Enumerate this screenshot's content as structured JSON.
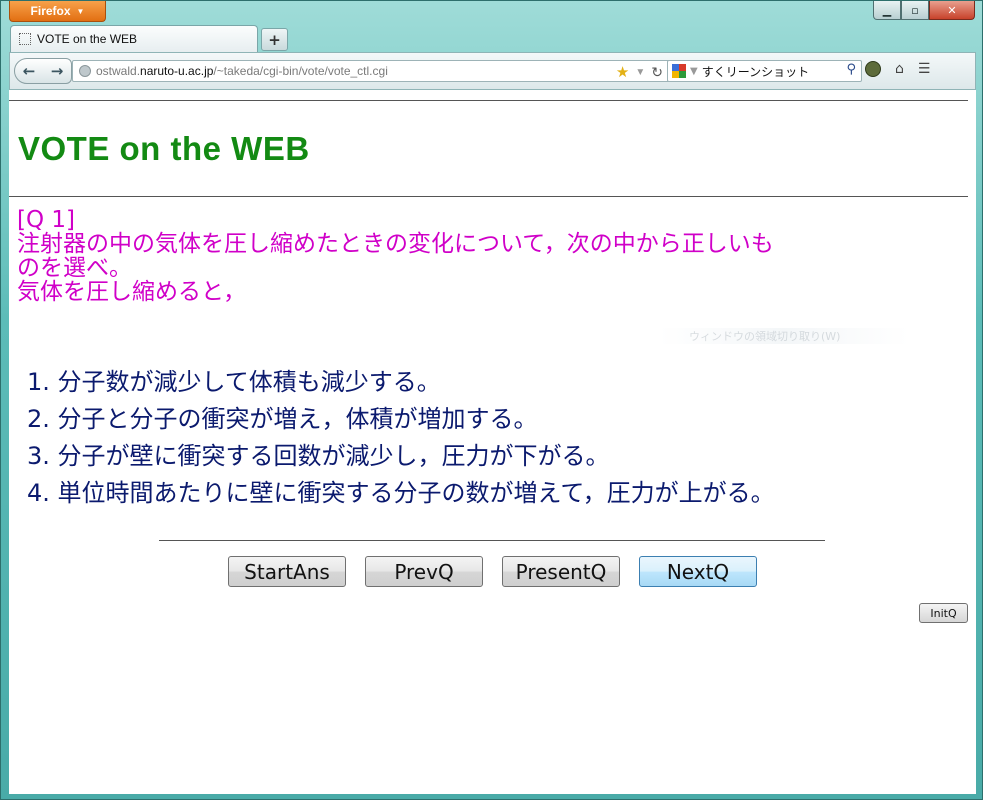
{
  "browser": {
    "menu_label": "Firefox",
    "tab_title": "VOTE on the WEB",
    "new_tab_symbol": "+",
    "url_prefix": "ostwald.",
    "url_host": "naruto-u.ac.jp",
    "url_path": "/~takeda/cgi-bin/vote/vote_ctl.cgi",
    "search_text": "すくリーンショット",
    "window_controls": {
      "minimize": "▁",
      "maximize": "▫",
      "close": "✕"
    }
  },
  "page": {
    "heading": "VOTE on the WEB",
    "question_number": "[Q 1]",
    "question_lines": [
      "注射器の中の気体を圧し縮めたときの変化について，次の中から正しいも",
      "のを選べ。",
      "気体を圧し縮めると，"
    ],
    "ghost_tooltip": "ウィンドウの領域切り取り(W)",
    "choices": [
      "1. 分子数が減少して体積も減少する。",
      "2. 分子と分子の衝突が増え，体積が増加する。",
      "3. 分子が壁に衝突する回数が減少し，圧力が下がる。",
      "4. 単位時間あたりに壁に衝突する分子の数が増えて，圧力が上がる。"
    ],
    "buttons": {
      "start": "StartAns",
      "prev": "PrevQ",
      "present": "PresentQ",
      "next": "NextQ",
      "init": "InitQ"
    }
  },
  "colors": {
    "heading": "#138a13",
    "question": "#d000c8",
    "choices": "#0b1a6e",
    "menu_button": "#e26f12"
  },
  "icons": [
    "back-arrow-icon",
    "forward-arrow-icon",
    "globe-icon",
    "bookmark-star-icon",
    "reload-icon",
    "google-icon",
    "search-icon",
    "addon-icon",
    "home-icon",
    "bookmarks-icon"
  ]
}
